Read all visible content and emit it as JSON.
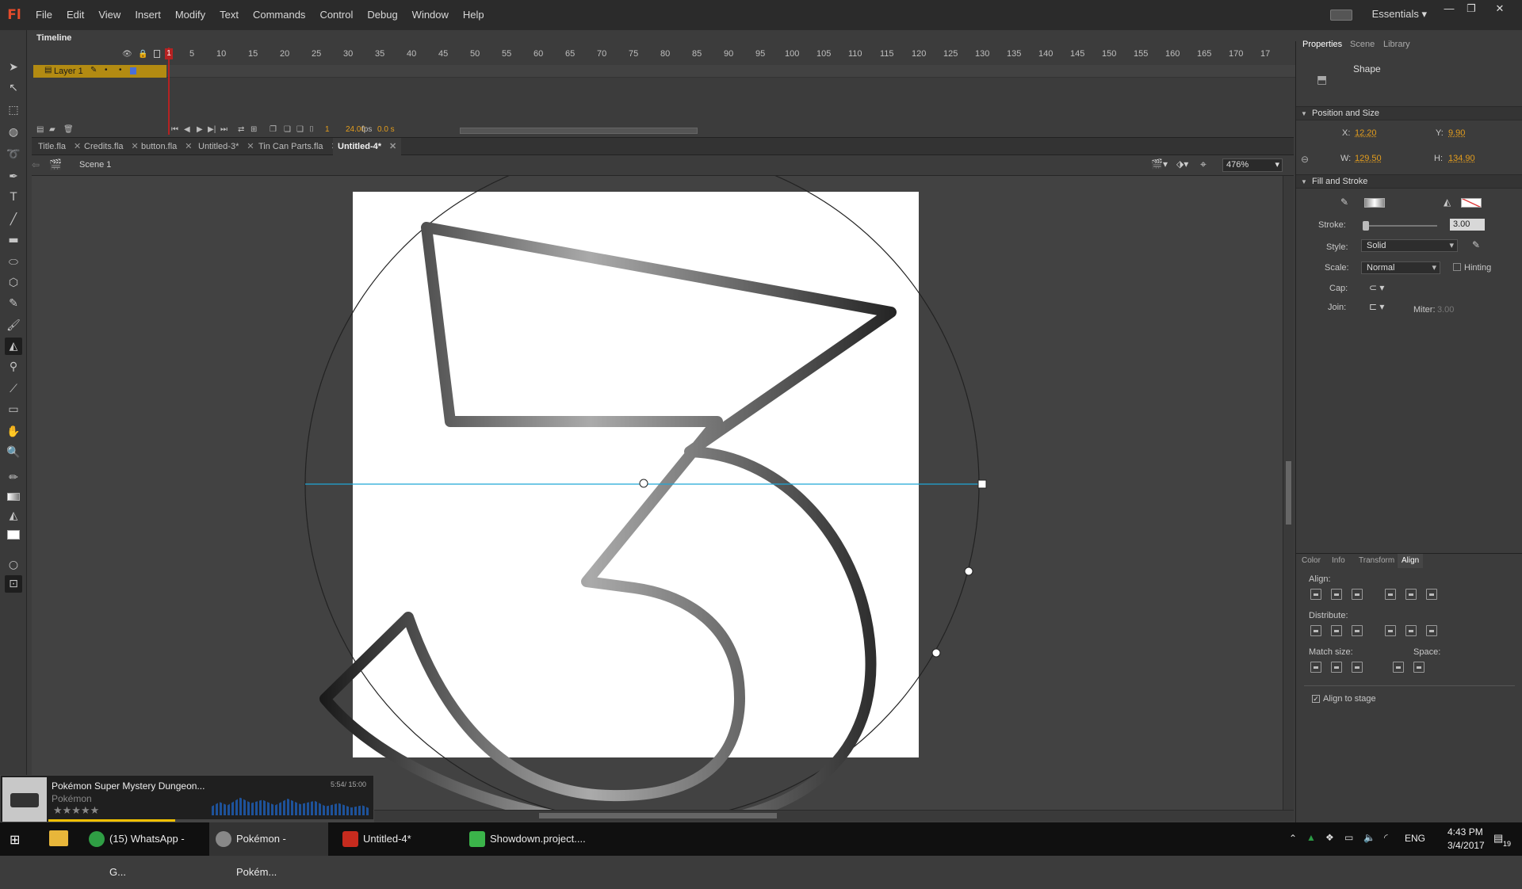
{
  "app": {
    "logo": "Fl",
    "workspace": "Essentials"
  },
  "menu": [
    "File",
    "Edit",
    "View",
    "Insert",
    "Modify",
    "Text",
    "Commands",
    "Control",
    "Debug",
    "Window",
    "Help"
  ],
  "timeline": {
    "title": "Timeline",
    "ruler": [
      "1",
      "5",
      "10",
      "15",
      "20",
      "25",
      "30",
      "35",
      "40",
      "45",
      "50",
      "55",
      "60",
      "65",
      "70",
      "75",
      "80",
      "85",
      "90",
      "95",
      "100",
      "105",
      "110",
      "115",
      "120",
      "125",
      "130",
      "135",
      "140",
      "145",
      "150",
      "155",
      "160",
      "165",
      "170",
      "17"
    ],
    "layer_name": "Layer 1",
    "current_frame": "1",
    "fps": "24.00",
    "fps_unit": "fps",
    "time": "0.0 s"
  },
  "tabs": [
    {
      "label": "Title.fla",
      "active": false
    },
    {
      "label": "Credits.fla",
      "active": false
    },
    {
      "label": "button.fla",
      "active": false
    },
    {
      "label": "Untitled-3*",
      "active": false
    },
    {
      "label": "Tin Can Parts.fla",
      "active": false
    },
    {
      "label": "Untitled-4*",
      "active": true
    }
  ],
  "editbar": {
    "scene": "Scene 1",
    "zoom": "476%"
  },
  "properties": {
    "tabs": [
      "Properties",
      "Scene",
      "Library"
    ],
    "object_type": "Shape",
    "position_section": "Position and Size",
    "x_label": "X:",
    "x": "12.20",
    "y_label": "Y:",
    "y": "9.90",
    "w_label": "W:",
    "w": "129.50",
    "h_label": "H:",
    "h": "134.90",
    "fill_section": "Fill and Stroke",
    "stroke_label": "Stroke:",
    "stroke": "3.00",
    "style_label": "Style:",
    "style": "Solid",
    "scale_label": "Scale:",
    "scale": "Normal",
    "hinting": "Hinting",
    "cap_label": "Cap:",
    "join_label": "Join:",
    "miter_label": "Miter:",
    "miter": "3.00"
  },
  "align_panel": {
    "tabs": [
      "Color",
      "Info",
      "Transform",
      "Align"
    ],
    "align": "Align:",
    "distribute": "Distribute:",
    "match_size": "Match size:",
    "space": "Space:",
    "align_to_stage": "Align to stage"
  },
  "media": {
    "title": "Pokémon Super Mystery Dungeon...",
    "artist": "Pokémon",
    "time": "5:54/ 15:00",
    "rating": "★★★★★",
    "progress": 0.39
  },
  "taskbar": {
    "items": [
      {
        "label": "(15) WhatsApp - G...",
        "color": "#2f9e44"
      },
      {
        "label": "Pokémon - Pokém...",
        "color": "#888888"
      },
      {
        "label": "Untitled-4*",
        "color": "#c62b1e"
      },
      {
        "label": "Showdown.project....",
        "color": "#3bb44a"
      }
    ],
    "lang": "ENG",
    "time": "4:43 PM",
    "date": "3/4/2017",
    "notifications": "19"
  }
}
